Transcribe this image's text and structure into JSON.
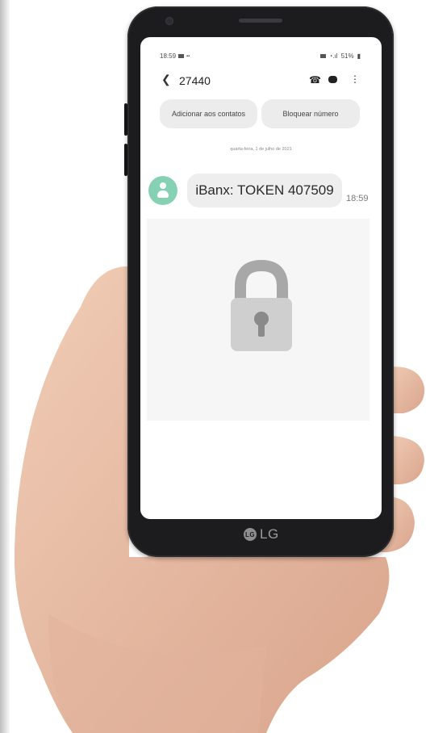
{
  "status_bar": {
    "time": "18:59",
    "battery": "51%"
  },
  "conversation": {
    "number": "27440",
    "actions": {
      "add_contact": "Adicionar aos contatos",
      "block_number": "Bloquear número"
    },
    "date_separator": "quarta-feira, 1 de julho de 2021",
    "messages": [
      {
        "text": "iBanx: TOKEN 407509",
        "time": "18:59"
      }
    ]
  },
  "device": {
    "brand": "LG"
  },
  "colors": {
    "avatar": "#86d1b4",
    "lock_body": "#cfcfcf",
    "lock_shackle": "#a8a8a8"
  }
}
